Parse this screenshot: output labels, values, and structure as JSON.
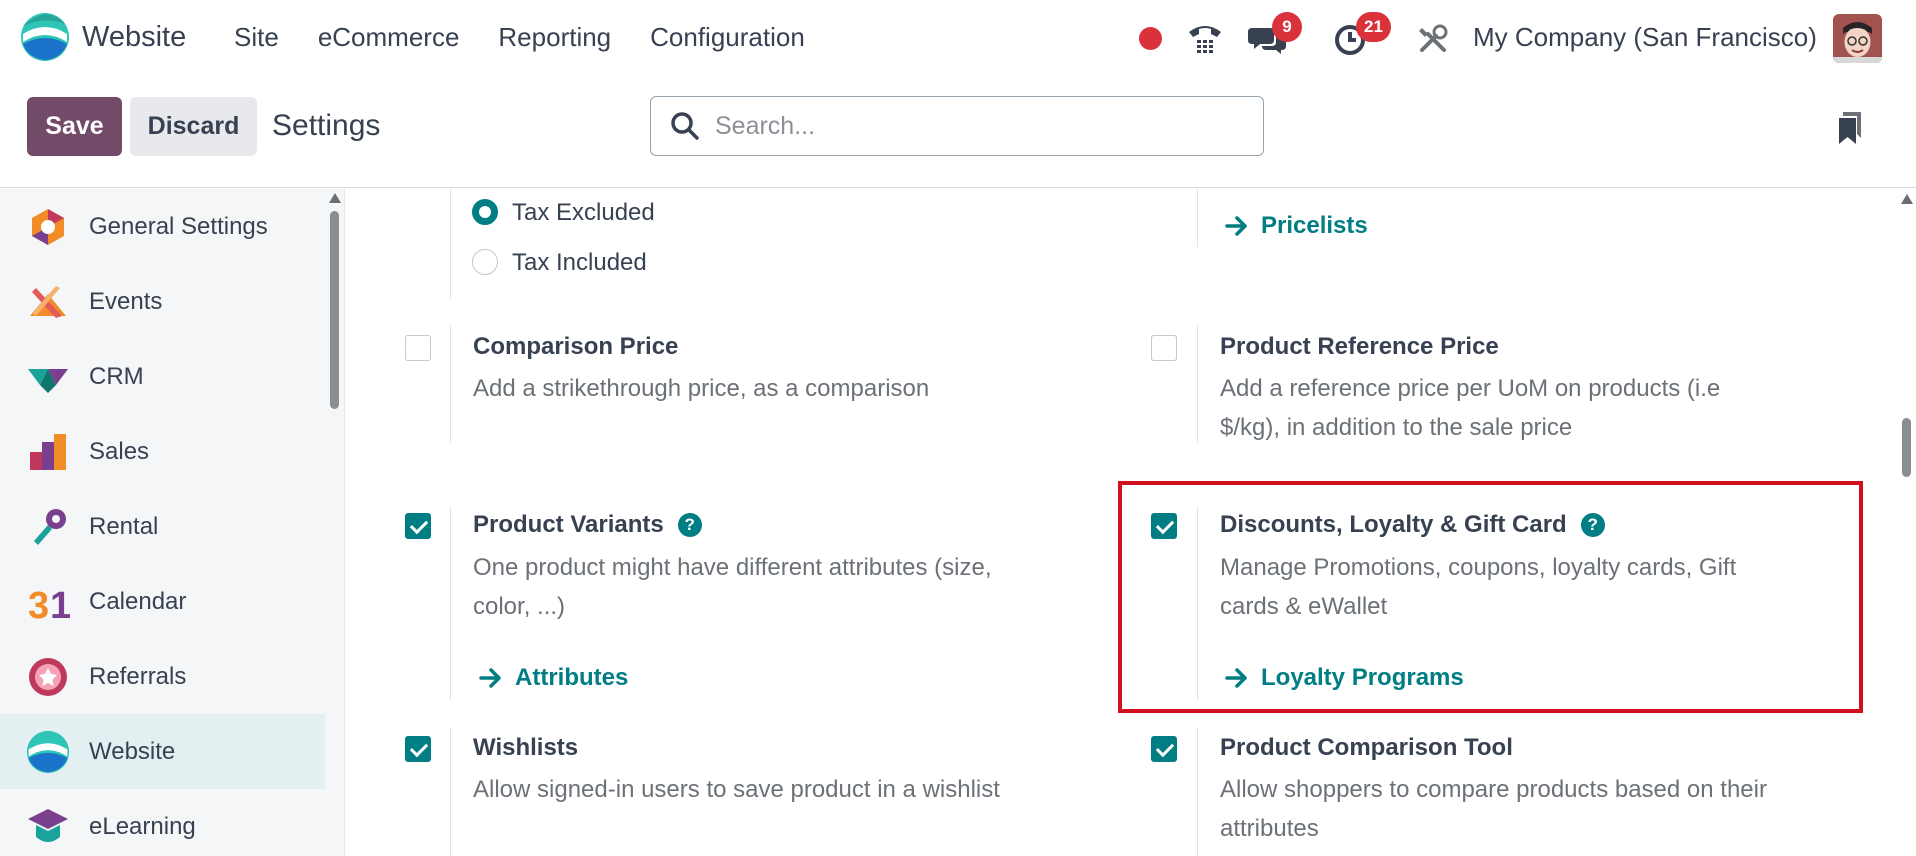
{
  "navbar": {
    "app_name": "Website",
    "menu": [
      "Site",
      "eCommerce",
      "Reporting",
      "Configuration"
    ],
    "messages_count": "9",
    "activities_count": "21",
    "company": "My Company (San Francisco)"
  },
  "control": {
    "save_label": "Save",
    "discard_label": "Discard",
    "title": "Settings",
    "search_placeholder": "Search..."
  },
  "sidebar": {
    "items": [
      {
        "label": "General Settings",
        "icon": "general-settings-icon"
      },
      {
        "label": "Events",
        "icon": "events-icon"
      },
      {
        "label": "CRM",
        "icon": "crm-icon"
      },
      {
        "label": "Sales",
        "icon": "sales-icon"
      },
      {
        "label": "Rental",
        "icon": "rental-icon"
      },
      {
        "label": "Calendar",
        "icon": "calendar-icon"
      },
      {
        "label": "Referrals",
        "icon": "referrals-icon"
      },
      {
        "label": "Website",
        "icon": "website-icon",
        "active": true
      },
      {
        "label": "eLearning",
        "icon": "elearning-icon"
      }
    ]
  },
  "settings": {
    "tax": {
      "option_excluded": "Tax Excluded",
      "option_included": "Tax Included",
      "selected": "Tax Excluded"
    },
    "pricelists_link": "Pricelists",
    "comparison_price": {
      "title": "Comparison Price",
      "desc": "Add a strikethrough price, as a comparison",
      "checked": false
    },
    "product_reference_price": {
      "title": "Product Reference Price",
      "desc_line1": "Add a reference price per UoM on products (i.e",
      "desc_line2": "$/kg), in addition to the sale price",
      "checked": false
    },
    "product_variants": {
      "title": "Product Variants",
      "desc_line1": "One product might have different attributes (size,",
      "desc_line2": "color, ...)",
      "link": "Attributes",
      "checked": true
    },
    "discounts_loyalty": {
      "title": "Discounts, Loyalty & Gift Card",
      "desc_line1": "Manage Promotions, coupons, loyalty cards, Gift",
      "desc_line2": "cards & eWallet",
      "link": "Loyalty Programs",
      "checked": true
    },
    "wishlists": {
      "title": "Wishlists",
      "desc": "Allow signed-in users to save product in a wishlist",
      "checked": true
    },
    "product_comparison": {
      "title": "Product Comparison Tool",
      "desc_line1": "Allow shoppers to compare products based on their",
      "desc_line2": "attributes",
      "checked": true
    }
  },
  "colors": {
    "brand": "#714b67",
    "accent": "#017e84",
    "highlight": "#d0101e",
    "badge": "#d9323a"
  }
}
